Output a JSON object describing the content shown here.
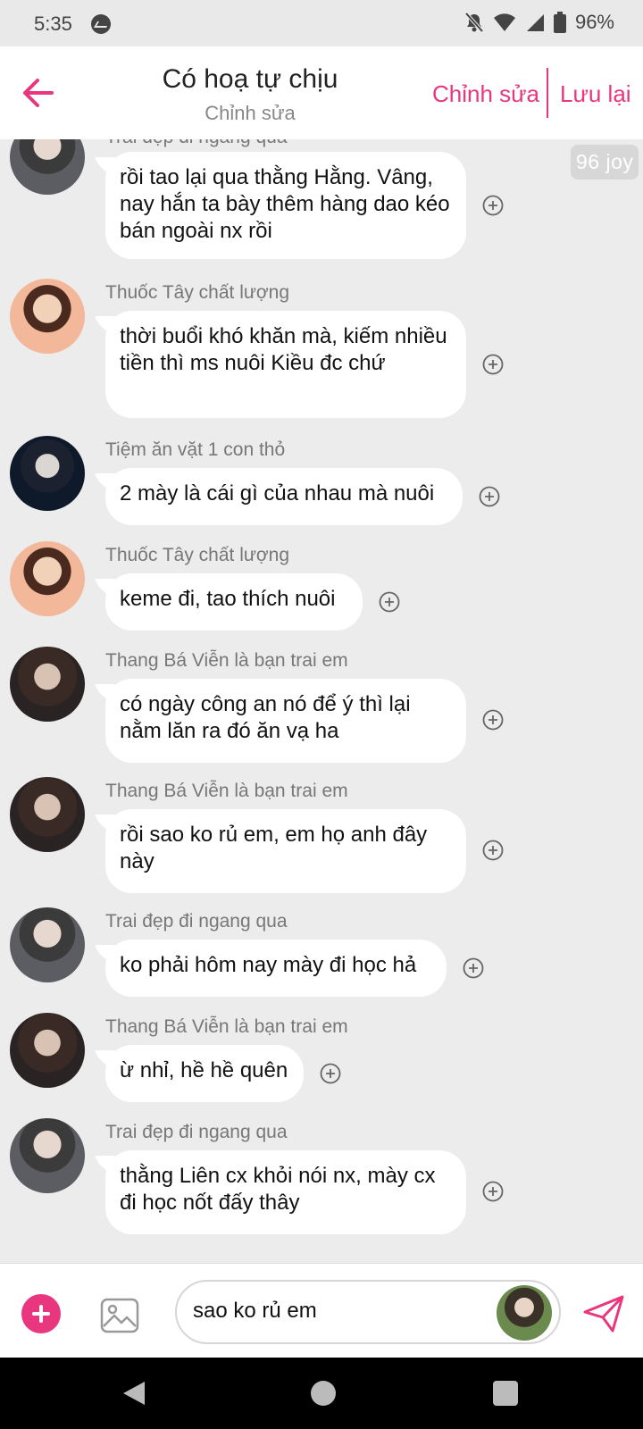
{
  "status_bar": {
    "time": "5:35",
    "battery": "96%"
  },
  "header": {
    "title": "Có hoạ tự chịu",
    "subtitle": "Chỉnh sửa",
    "edit_label": "Chỉnh sửa",
    "save_label": "Lưu lại"
  },
  "joy_badge": "96 joy",
  "messages": [
    {
      "sender": "Trai đẹp đi ngang qua",
      "text": "rồi tao lại qua thằng Hằng. Vâng, nay hắn ta bày thêm hàng dao kéo bán ngoài nx rồi"
    },
    {
      "sender": "Thuốc Tây chất lượng",
      "text": "thời buổi khó khăn mà, kiếm nhiều tiền thì ms nuôi Kiều đc chứ"
    },
    {
      "sender": "Tiệm ăn vặt 1 con thỏ",
      "text": "2 mày là cái gì của nhau mà nuôi"
    },
    {
      "sender": "Thuốc Tây chất lượng",
      "text": "keme đi, tao thích nuôi"
    },
    {
      "sender": "Thang Bá Viễn là bạn trai em",
      "text": "có ngày công an nó để ý thì lại nằm lăn ra đó ăn vạ ha"
    },
    {
      "sender": "Thang Bá Viễn là bạn trai em",
      "text": "rồi sao ko rủ em, em họ anh đây này"
    },
    {
      "sender": "Trai đẹp đi ngang qua",
      "text": "ko phải hôm nay mày đi học hả"
    },
    {
      "sender": "Thang Bá Viễn là bạn trai em",
      "text": "ừ nhỉ, hề hề quên"
    },
    {
      "sender": "Trai đẹp đi ngang qua",
      "text": "thằng Liên cx khỏi nói nx, mày cx đi học nốt đấy thây"
    }
  ],
  "composer": {
    "input_value": "sao ko rủ em"
  },
  "colors": {
    "accent": "#e8377f",
    "chat_bg": "#ececec",
    "bubble": "#ffffff"
  }
}
